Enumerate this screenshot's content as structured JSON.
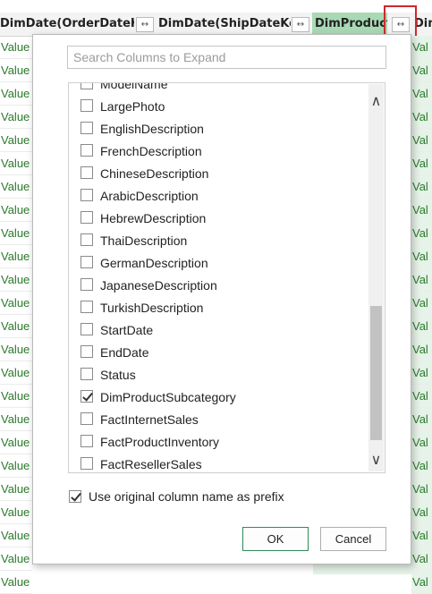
{
  "header": {
    "col1": "DimDate(OrderDateKey)",
    "col2": "DimDate(ShipDateKey)",
    "col3": "DimProduct",
    "col4": "Dim",
    "expand_glyph": "↔"
  },
  "grid": {
    "left_cells": [
      "Value",
      "Value",
      "Value",
      "Value",
      "Value",
      "Value",
      "Value",
      "Value",
      "Value",
      "Value",
      "Value",
      "Value",
      "Value",
      "Value",
      "Value",
      "Value",
      "Value",
      "Value",
      "Value",
      "Value",
      "Value",
      "Value",
      "Value",
      "Value"
    ],
    "right_cells": [
      "Val",
      "Val",
      "Val",
      "Val",
      "Val",
      "Val",
      "Val",
      "Val",
      "Val",
      "Val",
      "Val",
      "Val",
      "Val",
      "Val",
      "Val",
      "Val",
      "Val",
      "Val",
      "Val",
      "Val",
      "Val",
      "Val",
      "Val",
      "Val"
    ]
  },
  "dialog": {
    "search_placeholder": "Search Columns to Expand",
    "columns": [
      {
        "label": "ModelName",
        "checked": false
      },
      {
        "label": "LargePhoto",
        "checked": false
      },
      {
        "label": "EnglishDescription",
        "checked": false
      },
      {
        "label": "FrenchDescription",
        "checked": false
      },
      {
        "label": "ChineseDescription",
        "checked": false
      },
      {
        "label": "ArabicDescription",
        "checked": false
      },
      {
        "label": "HebrewDescription",
        "checked": false
      },
      {
        "label": "ThaiDescription",
        "checked": false
      },
      {
        "label": "GermanDescription",
        "checked": false
      },
      {
        "label": "JapaneseDescription",
        "checked": false
      },
      {
        "label": "TurkishDescription",
        "checked": false
      },
      {
        "label": "StartDate",
        "checked": false
      },
      {
        "label": "EndDate",
        "checked": false
      },
      {
        "label": "Status",
        "checked": false
      },
      {
        "label": "DimProductSubcategory",
        "checked": true
      },
      {
        "label": "FactInternetSales",
        "checked": false
      },
      {
        "label": "FactProductInventory",
        "checked": false
      },
      {
        "label": "FactResellerSales",
        "checked": false
      }
    ],
    "scroll_up_glyph": "∧",
    "scroll_down_glyph": "∨",
    "prefix_label": "Use original column name as prefix",
    "prefix_checked": true,
    "ok_label": "OK",
    "cancel_label": "Cancel"
  },
  "colors": {
    "selected_header": "#a9d9b4",
    "value_text": "#2a7a2a",
    "highlight_box": "#d0282e",
    "ok_border": "#2f8a57"
  }
}
